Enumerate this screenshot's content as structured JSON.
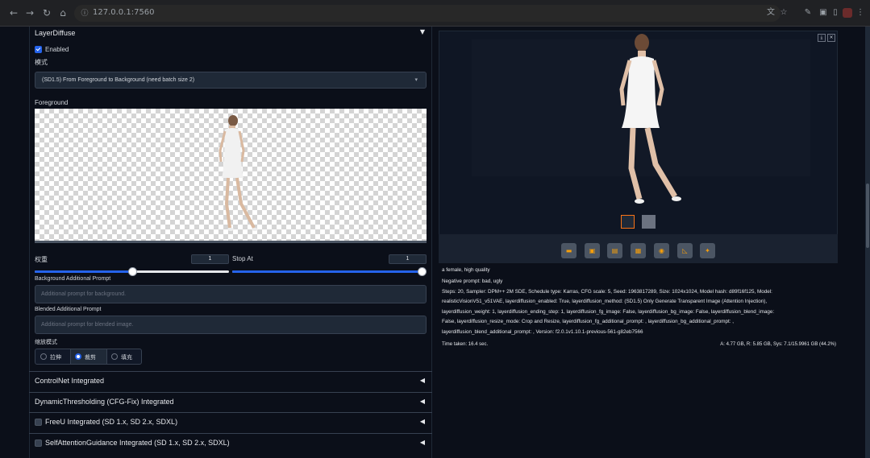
{
  "browser": {
    "url": "127.0.0.1:7560"
  },
  "layerdiffuse": {
    "title": "LayerDiffuse",
    "enabled_label": "Enabled",
    "method_label": "模式",
    "method_value": "(SD1.5) From Foreground to Background (need batch size 2)",
    "foreground_label": "Foreground",
    "weight_label": "权重",
    "weight_value": "1",
    "weight_fraction": 0.5,
    "stop_at_label": "Stop At",
    "stop_at_value": "1",
    "stop_at_fraction": 1.0,
    "bg_prompt_label": "Background Additional Prompt",
    "bg_prompt_placeholder": "Additional prompt for background.",
    "blended_prompt_label": "Blended Additional Prompt",
    "blended_prompt_placeholder": "Additional prompt for blended image.",
    "resize_mode_label": "缩放模式",
    "resize_options": [
      "拉伸",
      "裁剪",
      "填充"
    ],
    "resize_selected": "裁剪"
  },
  "sections": [
    {
      "title": "ControlNet Integrated",
      "has_checkbox": false
    },
    {
      "title": "DynamicThresholding (CFG-Fix) Integrated",
      "has_checkbox": false
    },
    {
      "title": "FreeU Integrated (SD 1.x, SD 2.x, SDXL)",
      "has_checkbox": true
    },
    {
      "title": "SelfAttentionGuidance Integrated (SD 1.x, SD 2.x, SDXL)",
      "has_checkbox": true
    }
  ],
  "output": {
    "prompt": "a female, high quality",
    "negative": "Negative prompt: bad, ugly",
    "params_lines": [
      "Steps: 20, Sampler: DPM++ 2M SDE, Schedule type: Karras, CFG scale: 5, Seed: 1963817289, Size: 1024x1024, Model hash: d89f16f125, Model:",
      "realisticVisionV51_v51VAE, layerdiffusion_enabled: True, layerdiffusion_method: (SD1.5) Only Generate Transparent Image (Attention Injection),",
      "layerdiffusion_weight: 1, layerdiffusion_ending_step: 1, layerdiffusion_fg_image: False, layerdiffusion_bg_image: False, layerdiffusion_blend_image:",
      "False, layerdiffusion_resize_mode: Crop and Resize, layerdiffusion_fg_additional_prompt: , layerdiffusion_bg_additional_prompt: ,",
      "layerdiffusion_blend_additional_prompt: , Version: f2.0.1v1.10.1-previous-561-g82eb7566"
    ],
    "time_taken": "Time taken: 16.4 sec.",
    "vram": "A: 4.77 GB, R: 5.85 GB, Sys: 7.1/15.9961 GB (44.2%)"
  },
  "colors": {
    "accent": "#2563eb",
    "panel_bg": "#0b0f19",
    "tool_icon": "#f59e0b"
  }
}
